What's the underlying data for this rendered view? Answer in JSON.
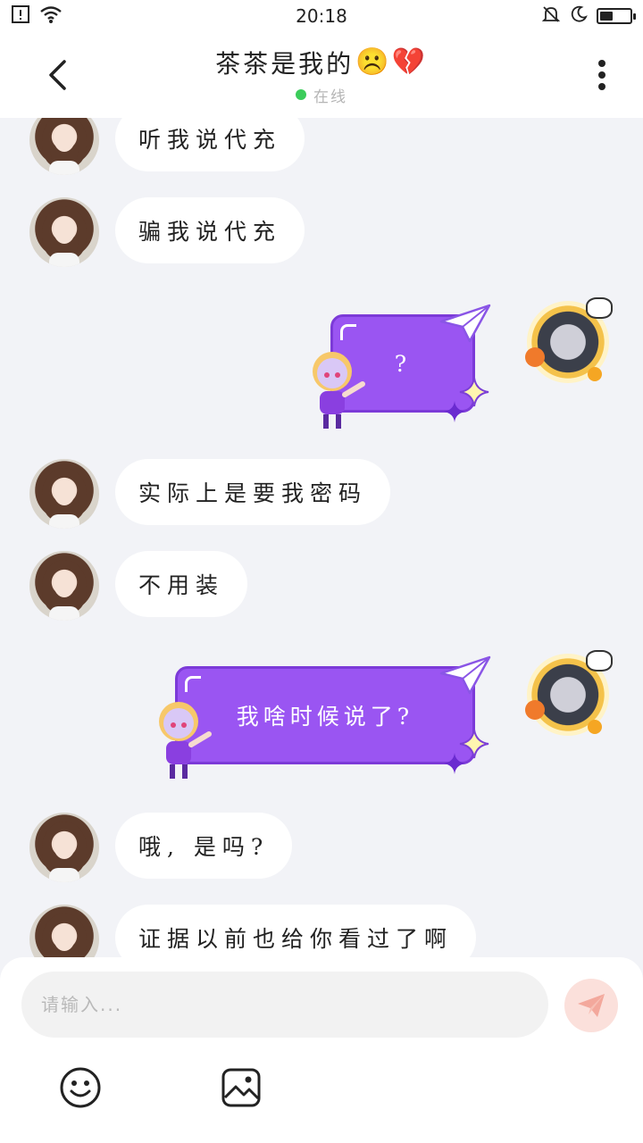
{
  "status_bar": {
    "time": "20:18",
    "battery_level": 0.45
  },
  "header": {
    "title": "茶茶是我的",
    "title_emojis": "☹️💔",
    "status": "在线",
    "status_color": "#3bcc5a"
  },
  "messages": [
    {
      "side": "left",
      "text": "听我说代充"
    },
    {
      "side": "left",
      "text": "骗我说代充"
    },
    {
      "side": "right",
      "text": "?"
    },
    {
      "side": "left",
      "text": "实际上是要我密码"
    },
    {
      "side": "left",
      "text": "不用装"
    },
    {
      "side": "right",
      "text": "我啥时候说了?"
    },
    {
      "side": "left",
      "text": "哦, 是吗?"
    },
    {
      "side": "left",
      "text": "证据以前也给你看过了啊"
    }
  ],
  "input": {
    "placeholder": "请输入..."
  },
  "colors": {
    "bubble_purple": "#9a55f2",
    "bubble_left": "#ffffff",
    "chat_background": "#f2f3f7",
    "send_button": "#fbe0db",
    "send_icon": "#f3a89c"
  },
  "icons": {
    "back": "chevron-left-icon",
    "more": "more-vertical-icon",
    "send": "paper-plane-icon",
    "emoji": "smiley-icon",
    "image": "image-icon"
  }
}
